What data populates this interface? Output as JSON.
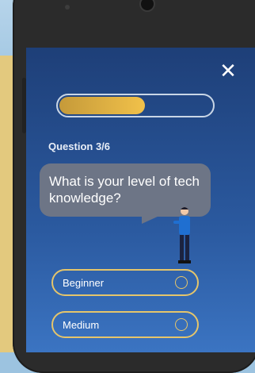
{
  "quiz": {
    "question_counter": "Question 3/6",
    "question_text": "What is your level of tech knowledge?",
    "progress": 0.56,
    "options": [
      {
        "label": "Beginner"
      },
      {
        "label": "Medium"
      }
    ]
  },
  "colors": {
    "accent": "#f1c14a",
    "option_border": "#e5c56b",
    "bubble": "#6d7586",
    "screen_top": "#1e3f78"
  },
  "icons": {
    "close": "close-icon",
    "avatar": "person-illustration"
  }
}
